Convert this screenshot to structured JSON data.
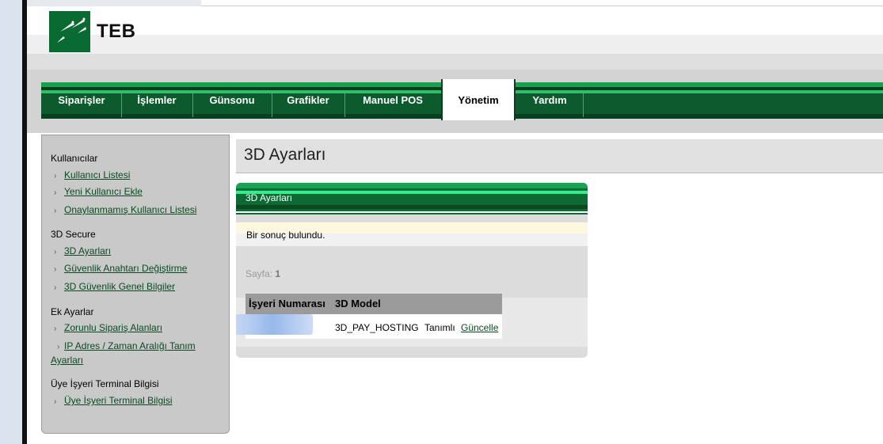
{
  "brand": {
    "name": "TEB"
  },
  "nav": {
    "items": [
      {
        "label": "Siparişler"
      },
      {
        "label": "İşlemler"
      },
      {
        "label": "Günsonu"
      },
      {
        "label": "Grafikler"
      },
      {
        "label": "Manuel POS"
      },
      {
        "label": "Yönetim",
        "active": true
      },
      {
        "label": "Yardım"
      }
    ]
  },
  "sidebar": {
    "groups": [
      {
        "title": "Kullanıcılar",
        "links": [
          "Kullanıcı Listesi",
          "Yeni Kullanıcı Ekle",
          "Onaylanmamış Kullanıcı Listesi"
        ]
      },
      {
        "title": "3D Secure",
        "links": [
          "3D Ayarları",
          "Güvenlik Anahtarı Değiştirme",
          "3D Güvenlik Genel Bilgiler"
        ]
      },
      {
        "title": "Ek Ayarlar",
        "links": [
          "Zorunlu Sipariş Alanları",
          "IP Adres / Zaman Aralığı Tanım Ayarları"
        ]
      },
      {
        "title": "Üye İşyeri Terminal Bilgisi",
        "links": [
          "Üye İşyeri Terminal Bilgisi"
        ]
      }
    ]
  },
  "page": {
    "title": "3D Ayarları"
  },
  "panel": {
    "title": "3D Ayarları",
    "message": "Bir sonuç bulundu.",
    "pager_label": "Sayfa:",
    "pager_value": "1",
    "table": {
      "headers": [
        "İşyeri Numarası",
        "3D Model"
      ],
      "rows": [
        {
          "model": "3D_PAY_HOSTING",
          "status": "Tanımlı",
          "action": "Güncelle"
        }
      ]
    }
  },
  "colors": {
    "brand_green": "#0c5a2e",
    "accent_green": "#2fbf64",
    "link": "#0a4a22"
  }
}
